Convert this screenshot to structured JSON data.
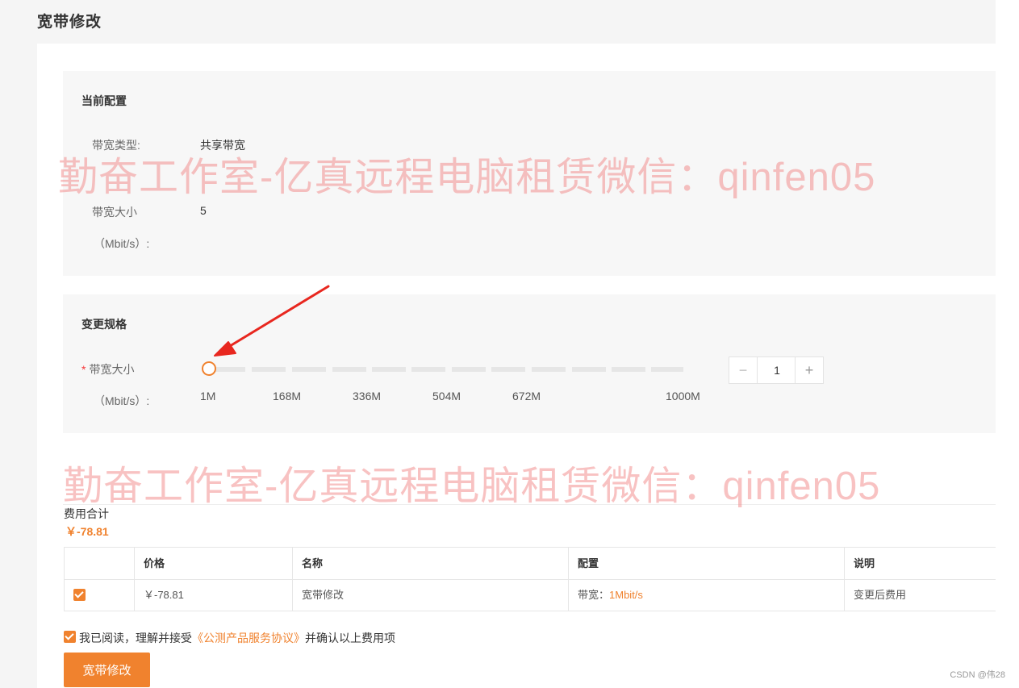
{
  "page": {
    "title": "宽带修改"
  },
  "current_config": {
    "title": "当前配置",
    "bandwidth_type_label": "带宽类型:",
    "bandwidth_type_value": "共享带宽",
    "bandwidth_size_label": "带宽大小",
    "bandwidth_unit": "（Mbit/s）:",
    "bandwidth_size_value": "5"
  },
  "change_spec": {
    "title": "变更规格",
    "required_mark": "*",
    "bandwidth_size_label": "带宽大小",
    "bandwidth_unit": "（Mbit/s）:",
    "slider": {
      "value": 1,
      "min": 1,
      "max": 1000,
      "ticks": [
        "1M",
        "168M",
        "336M",
        "504M",
        "672M",
        "1000M"
      ]
    },
    "stepper": {
      "minus": "−",
      "value": "1",
      "plus": "+"
    }
  },
  "cost": {
    "label": "费用合计",
    "value": "￥-78.81"
  },
  "table": {
    "headers": [
      "价格",
      "名称",
      "配置",
      "说明"
    ],
    "rows": [
      {
        "checked": true,
        "price": "￥-78.81",
        "name": "宽带修改",
        "config_label": "带宽：",
        "config_value": "1Mbit/s",
        "note": "变更后费用"
      }
    ]
  },
  "agreement": {
    "checked": true,
    "prefix": "我已阅读，理解并接受",
    "link": "《公测产品服务协议》",
    "suffix": "并确认以上费用项"
  },
  "submit_label": "宽带修改",
  "watermark_text": "勤奋工作室-亿真远程电脑租赁微信：qinfen05",
  "footer_credit": "CSDN @伟28",
  "colors": {
    "accent": "#f0822e",
    "watermark": "#ef7878",
    "required": "#f5383a"
  }
}
